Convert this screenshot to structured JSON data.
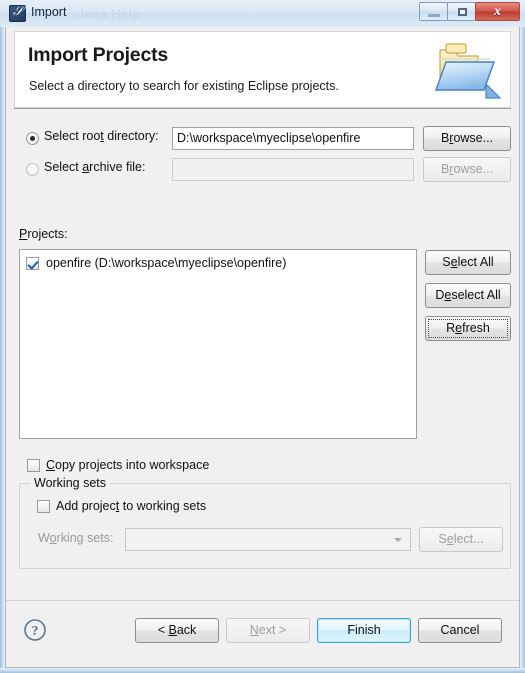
{
  "window": {
    "title": "Import",
    "ghost_text": "Java   Help",
    "icon": "eclipse-import-icon",
    "controls": {
      "minimize": "minimize-icon",
      "maximize": "maximize-icon",
      "close": "close-icon"
    }
  },
  "banner": {
    "title": "Import Projects",
    "subtitle": "Select a directory to search for existing Eclipse projects.",
    "icon": "open-folder-icon"
  },
  "source": {
    "root_directory": {
      "label_pre": "Select roo",
      "label_mnemonic": "t",
      "label_post": " directory:",
      "label_full": "Select root directory:",
      "value": "D:\\workspace\\myeclipse\\openfire",
      "selected": true,
      "browse_label_pre": "B",
      "browse_label_mnemonic": "r",
      "browse_label_post": "owse...",
      "browse_label_full": "Browse..."
    },
    "archive_file": {
      "label_pre": "Select ",
      "label_mnemonic": "a",
      "label_post": "rchive file:",
      "label_full": "Select archive file:",
      "value": "",
      "selected": false,
      "browse_label_pre": "B",
      "browse_label_mnemonic": "r",
      "browse_label_post": "owse...",
      "browse_label_full": "Browse..."
    }
  },
  "projects": {
    "label_mnemonic": "P",
    "label_post": "rojects:",
    "label_full": "Projects:",
    "items": [
      {
        "name": "openfire",
        "path": "D:\\workspace\\myeclipse\\openfire",
        "display": "openfire (D:\\workspace\\myeclipse\\openfire)",
        "checked": true
      }
    ],
    "buttons": {
      "select_all_pre": "S",
      "select_all_mnemonic": "e",
      "select_all_post": "lect All",
      "select_all_full": "Select All",
      "deselect_all_pre": "D",
      "deselect_all_mnemonic": "e",
      "deselect_all_post": "select All",
      "deselect_all_full": "Deselect All",
      "refresh_pre": "R",
      "refresh_mnemonic": "e",
      "refresh_post": "fresh",
      "refresh_full": "Refresh"
    }
  },
  "options": {
    "copy_projects": {
      "label_mnemonic": "C",
      "label_post": "opy projects into workspace",
      "label_full": "Copy projects into workspace",
      "checked": false
    },
    "working_sets_group": {
      "title": "Working sets",
      "add_project": {
        "label_pre": "Add projec",
        "label_mnemonic": "t",
        "label_post": " to working sets",
        "label_full": "Add project to working sets",
        "checked": false
      },
      "working_sets_field": {
        "label_pre": "W",
        "label_mnemonic": "o",
        "label_post": "rking sets:",
        "label_full": "Working sets:",
        "value": "",
        "disabled": true
      },
      "select_button": {
        "label_pre": "S",
        "label_mnemonic": "e",
        "label_post": "lect...",
        "label_full": "Select...",
        "disabled": true
      }
    }
  },
  "footer": {
    "help_icon": "help-icon",
    "back_pre": "< ",
    "back_mnemonic": "B",
    "back_post": "ack",
    "back_full": "< Back",
    "next_pre": "",
    "next_mnemonic": "N",
    "next_post": "ext >",
    "next_full": "Next >",
    "next_disabled": true,
    "finish_label": "Finish",
    "finish_default": true,
    "cancel_label": "Cancel"
  },
  "colors": {
    "accent": "#3c9fd6",
    "dialog_bg": "#f0f0f0",
    "close_button": "#d2564a",
    "check_mark": "#1d5fb0"
  }
}
